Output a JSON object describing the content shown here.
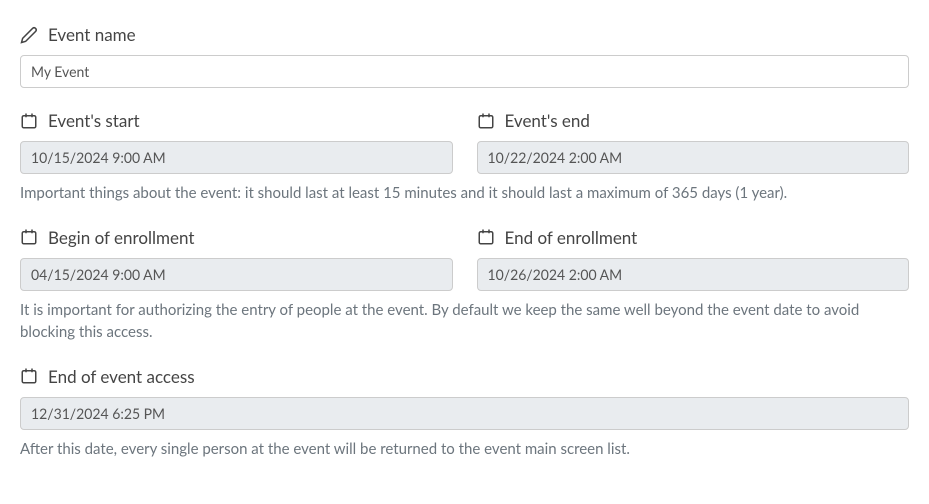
{
  "eventName": {
    "label": "Event name",
    "value": "My Event"
  },
  "eventStart": {
    "label": "Event's start",
    "value": "10/15/2024 9:00 AM"
  },
  "eventEnd": {
    "label": "Event's end",
    "value": "10/22/2024 2:00 AM"
  },
  "eventDatesHelp": "Important things about the event: it should last at least 15 minutes and it should last a maximum of 365 days (1 year).",
  "enrollBegin": {
    "label": "Begin of enrollment",
    "value": "04/15/2024 9:00 AM"
  },
  "enrollEnd": {
    "label": "End of enrollment",
    "value": "10/26/2024 2:00 AM"
  },
  "enrollHelp": "It is important for authorizing the entry of people at the event. By default we keep the same well beyond the event date to avoid blocking this access.",
  "accessEnd": {
    "label": "End of event access",
    "value": "12/31/2024 6:25 PM"
  },
  "accessHelp": "After this date, every single person at the event will be returned to the event main screen list."
}
